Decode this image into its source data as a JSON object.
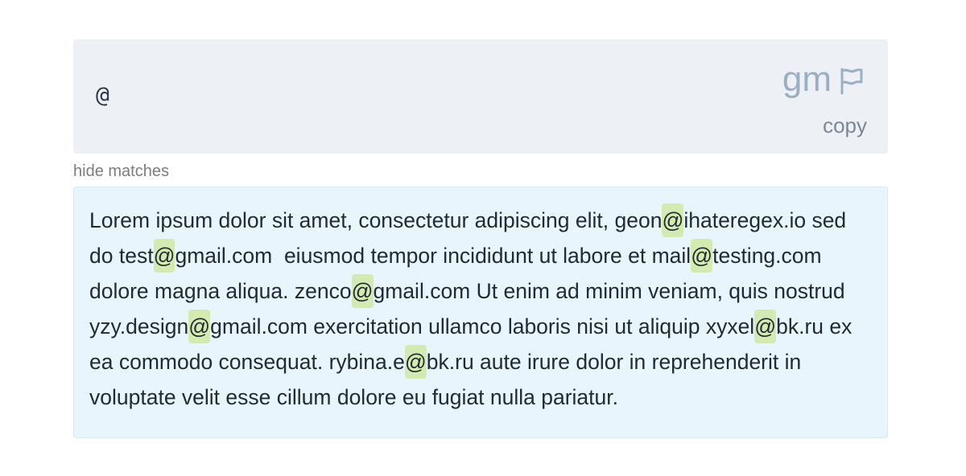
{
  "regex": {
    "pattern": "@",
    "flags": "gm",
    "copy_label": "copy"
  },
  "matches_toggle_label": "hide matches",
  "colors": {
    "regex_bg": "#edf1f5",
    "text_bg": "#e9f5fd",
    "match_highlight": "#d4eab0",
    "flags_color": "#9aaec4"
  },
  "icons": {
    "flag": "flag-icon"
  },
  "test_text": {
    "segments": [
      {
        "text": "Lorem ipsum dolor sit amet, consectetur adipiscing elit, geon",
        "match": false
      },
      {
        "text": "@",
        "match": true
      },
      {
        "text": "ihateregex.io sed do test",
        "match": false
      },
      {
        "text": "@",
        "match": true
      },
      {
        "text": "gmail.com  eiusmod tempor incididunt ut labore et mail",
        "match": false
      },
      {
        "text": "@",
        "match": true
      },
      {
        "text": "testing.com dolore magna aliqua. zenco",
        "match": false
      },
      {
        "text": "@",
        "match": true
      },
      {
        "text": "gmail.com Ut enim ad minim veniam, quis nostrud yzy.design",
        "match": false
      },
      {
        "text": "@",
        "match": true
      },
      {
        "text": "gmail.com exercitation ullamco laboris nisi ut aliquip xyxel",
        "match": false
      },
      {
        "text": "@",
        "match": true
      },
      {
        "text": "bk.ru ex ea commodo consequat. rybina.e",
        "match": false
      },
      {
        "text": "@",
        "match": true
      },
      {
        "text": "bk.ru aute irure dolor in reprehenderit in voluptate velit esse cillum dolore eu fugiat nulla pariatur.",
        "match": false
      }
    ]
  }
}
